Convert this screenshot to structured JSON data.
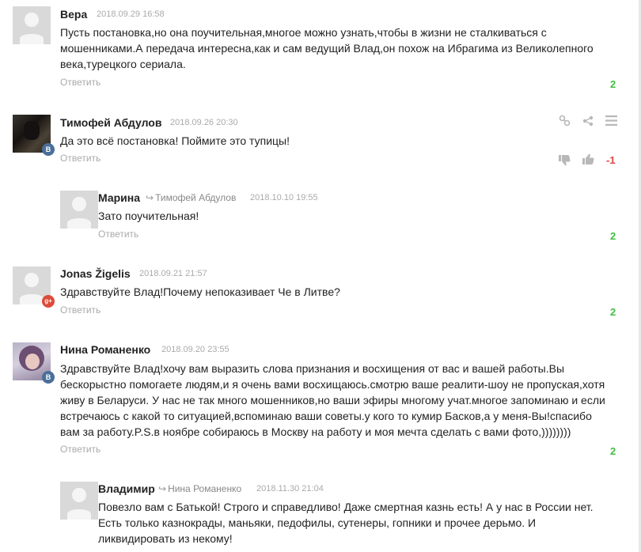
{
  "reply_label": "Ответить",
  "comments": [
    {
      "author": "Вера",
      "date": "2018.09.29 16:58",
      "lines": [
        "Пусть постановка,но она поучительная,многое можно узнать,чтобы в жизни  не сталкиваться с",
        "мошенниками.А передача интересна,как и сам ведущий Влад,он похож  на Ибрагима из Великолепного",
        "века,турецкого сериала."
      ],
      "score": "2"
    },
    {
      "author": "Тимофей Абдулов",
      "date": "2018.09.26 20:30",
      "lines": [
        "Да это всё постановка! Поймите это тупицы!"
      ],
      "score": "-1",
      "badge": "B"
    },
    {
      "author": "Марина",
      "reply_to": "Тимофей Абдулов",
      "date": "2018.10.10 19:55",
      "lines": [
        "Зато поучительная!"
      ],
      "score": "2"
    },
    {
      "author": "Jonas Žigelis",
      "date": "2018.09.21 21:57",
      "lines": [
        "Здравствуйте Влад!Почему непоказивает Че в Литве?"
      ],
      "score": "2",
      "badge": "g+"
    },
    {
      "author": "Нина Романенко",
      "date": "2018.09.20 23:55",
      "lines": [
        "Здравствуйте Влад!хочу вам выразить слова признания и восхищения от вас и вашей работы.Вы",
        "бескорыстно помогаете людям,и я очень вами восхищаюсь.смотрю ваше реалити-шоу не пропуская,хотя",
        "живу в Беларуси. У нас не так много мошенников,но ваши эфиры многому учат.многое запоминаю и если",
        "встречаюсь с какой то ситуацией,вспоминаю ваши советы.у кого то кумир Басков,а у меня-Вы!спасибо",
        "вам за работу.P.S.в ноябре собираюсь в Москву на работу и моя мечта сделать с вами фото,))))))))"
      ],
      "score": "2",
      "badge": "B"
    },
    {
      "author": "Владимир",
      "reply_to": "Нина Романенко",
      "date": "2018.11.30 21:04",
      "lines": [
        "Повезло вам с Батькой! Строго и справедливо! Даже смертная казнь есть! А у нас в России нет.",
        "Есть только казнокрады, маньяки, педофилы, сутенеры, гопники и прочее дерьмо. И",
        "ликвидировать из некому!"
      ]
    }
  ]
}
